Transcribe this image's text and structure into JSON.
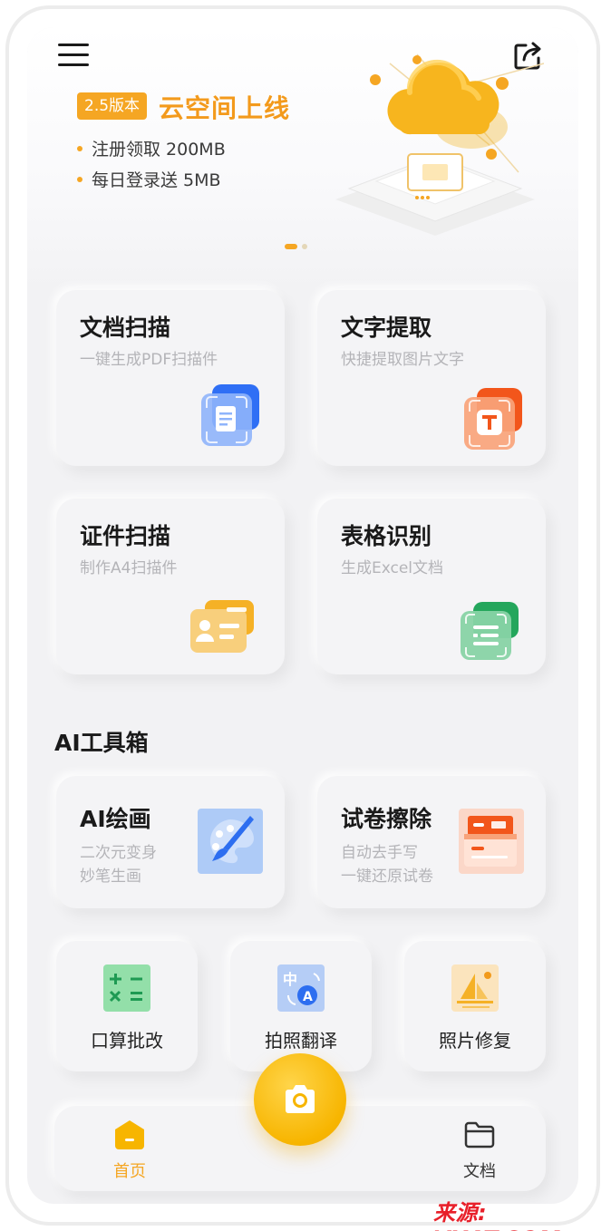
{
  "banner": {
    "version_badge": "2.5版本",
    "title": "云空间上线",
    "bullets": [
      "注册领取 200MB",
      "每日登录送 5MB"
    ],
    "icons": {
      "menu": "menu-icon",
      "share": "share-icon"
    },
    "carousel": {
      "total": 2,
      "active": 1
    }
  },
  "feature_cards": [
    {
      "title": "文档扫描",
      "subtitle": "一键生成PDF扫描件",
      "icon": "document-scan-icon",
      "color": "#3d7bf5"
    },
    {
      "title": "文字提取",
      "subtitle": "快捷提取图片文字",
      "icon": "text-extract-icon",
      "color": "#f46a2c"
    },
    {
      "title": "证件扫描",
      "subtitle": "制作A4扫描件",
      "icon": "id-card-icon",
      "color": "#f5b42a"
    },
    {
      "title": "表格识别",
      "subtitle": "生成Excel文档",
      "icon": "table-icon",
      "color": "#2fb36a"
    }
  ],
  "ai_toolbox": {
    "section_title": "AI工具箱",
    "cards": [
      {
        "title": "AI绘画",
        "lines": [
          "二次元变身",
          "妙笔生画"
        ],
        "icon": "paint-palette-icon"
      },
      {
        "title": "试卷擦除",
        "lines": [
          "自动去手写",
          "一键还原试卷"
        ],
        "icon": "exam-paper-icon"
      }
    ],
    "tools": [
      {
        "label": "口算批改",
        "icon": "calculator-icon"
      },
      {
        "label": "拍照翻译",
        "icon": "translate-icon"
      },
      {
        "label": "照片修复",
        "icon": "photo-restore-icon"
      }
    ]
  },
  "bottom_nav": {
    "items": [
      {
        "label": "首页",
        "icon": "home-icon",
        "active": true
      },
      {
        "label": "文档",
        "icon": "folder-icon",
        "active": false
      }
    ],
    "camera_icon": "camera-icon"
  },
  "colors": {
    "accent": "#f5a623",
    "background": "#f2f2f4",
    "watermark": "#e8202a"
  },
  "watermark": "来源: VXAT.COM"
}
